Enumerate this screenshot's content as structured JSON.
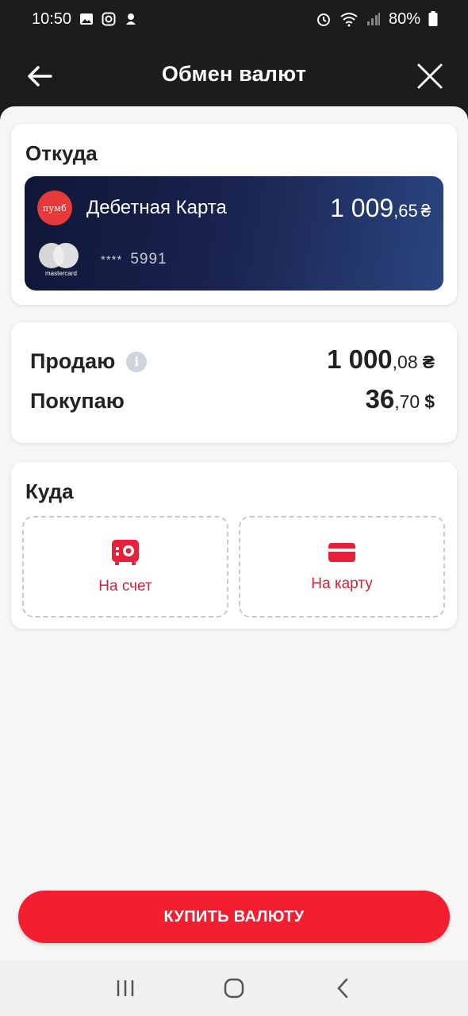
{
  "status_bar": {
    "time": "10:50",
    "battery": "80%",
    "icons": [
      "image-icon",
      "instagram-icon",
      "notification-icon",
      "alarm-icon",
      "wifi-icon",
      "signal-icon",
      "battery-icon"
    ]
  },
  "app_bar": {
    "title": "Обмен валют",
    "back_icon": "arrow-left-icon",
    "close_icon": "close-icon"
  },
  "from_section": {
    "title": "Откуда",
    "card": {
      "bank_logo_text": "пумб",
      "name": "Дебетная Карта",
      "balance_int": "1 009",
      "balance_dec": ",65",
      "currency": "₴",
      "mask_stars": "****",
      "last4": "5991",
      "payment_system": "mastercard"
    }
  },
  "amounts": {
    "sell_label": "Продаю",
    "sell_int": "1 000",
    "sell_dec": ",08",
    "sell_currency": "₴",
    "buy_label": "Покупаю",
    "buy_int": "36",
    "buy_dec": ",70",
    "buy_currency": "$"
  },
  "to_section": {
    "title": "Куда",
    "options": [
      {
        "label": "На счет",
        "icon": "safe-icon"
      },
      {
        "label": "На карту",
        "icon": "card-icon"
      }
    ]
  },
  "buy_button": {
    "label": "КУПИТЬ ВАЛЮТУ"
  },
  "colors": {
    "accent": "#f31f30",
    "accent_text": "#d81f3a",
    "card_gradient_start": "#0f1637",
    "card_gradient_end": "#2a4580"
  }
}
